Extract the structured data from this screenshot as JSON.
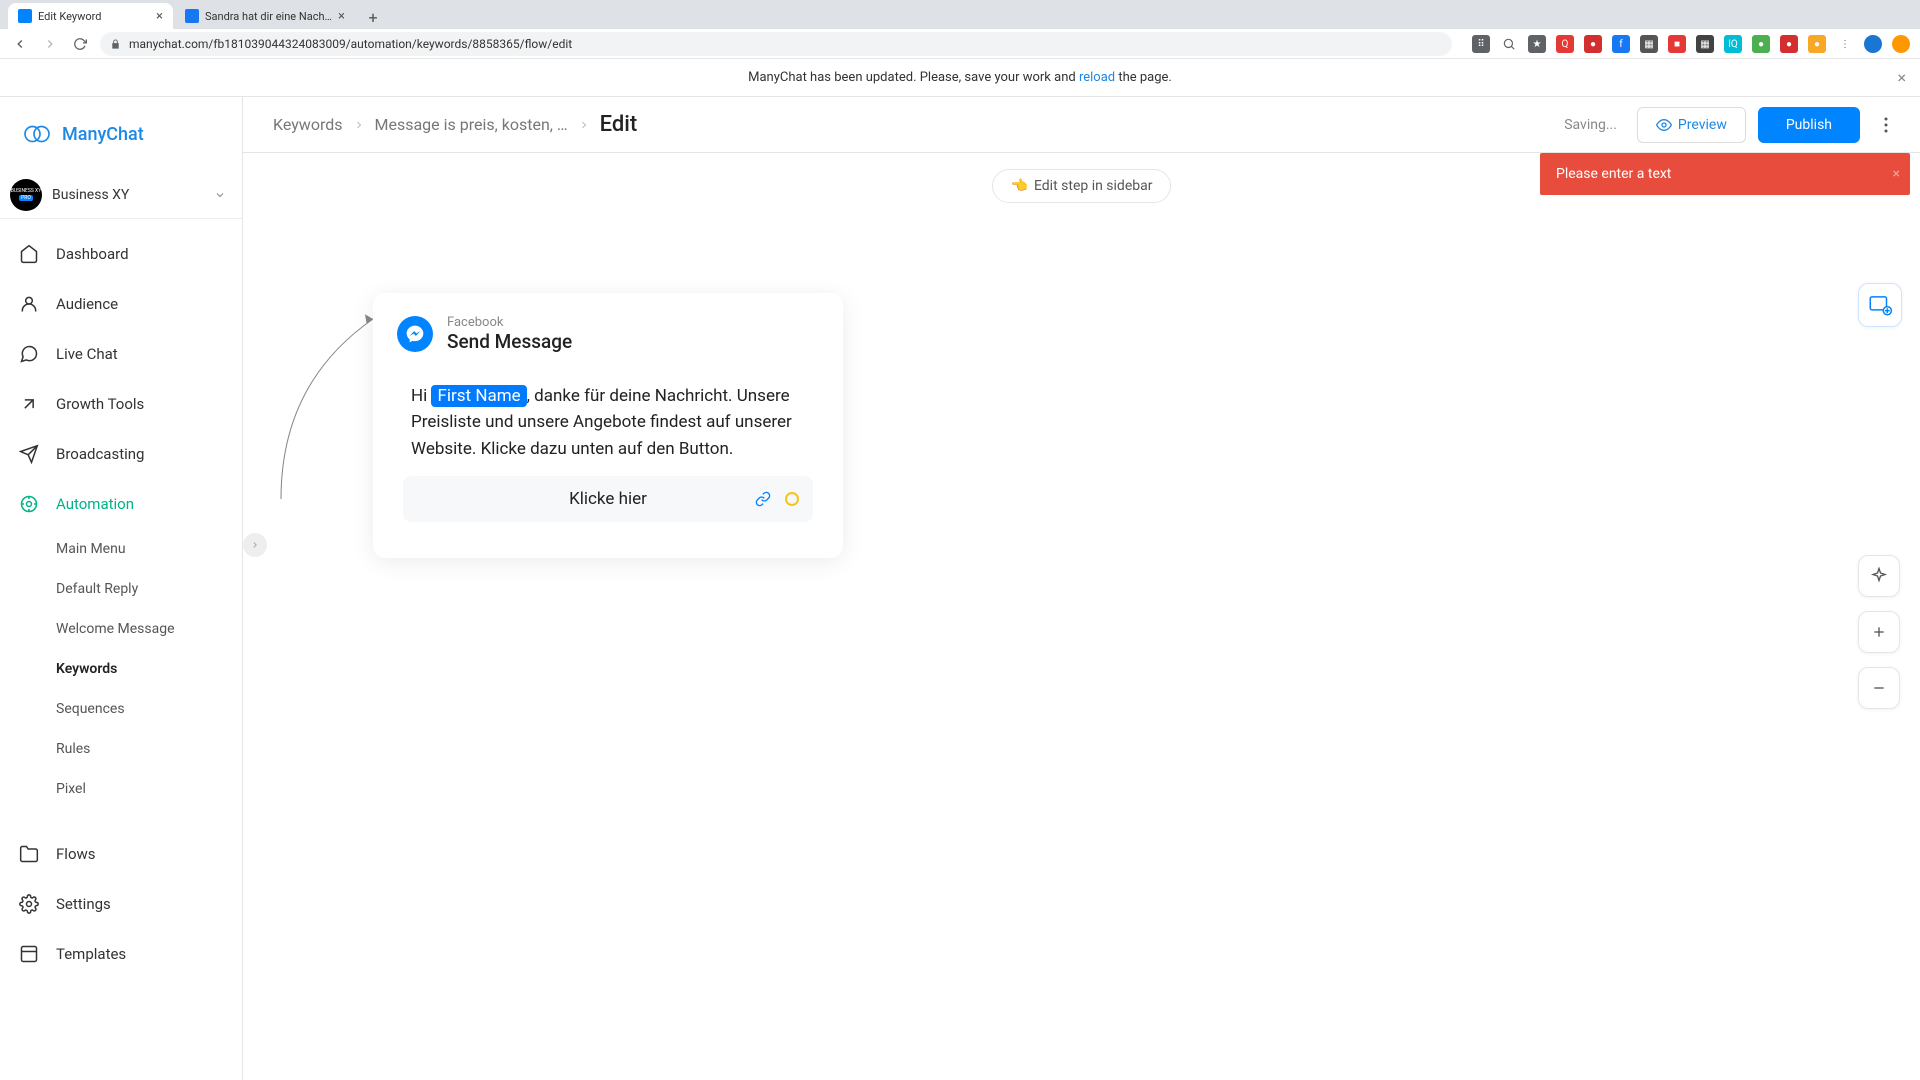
{
  "browser": {
    "tabs": [
      {
        "title": "Edit Keyword",
        "favicon_color": "#0084ff",
        "active": true
      },
      {
        "title": "Sandra hat dir eine Nachricht",
        "favicon_color": "#1877f2",
        "active": false
      }
    ],
    "url": "manychat.com/fb181039044324083009/automation/keywords/8858365/flow/edit"
  },
  "notification": {
    "prefix": "ManyChat has been updated. Please, save your work and ",
    "link": "reload",
    "suffix": " the page."
  },
  "app_name": "ManyChat",
  "workspace": {
    "name": "Business XY",
    "badge": "PRO"
  },
  "sidebar": {
    "items": [
      {
        "label": "Dashboard"
      },
      {
        "label": "Audience"
      },
      {
        "label": "Live Chat"
      },
      {
        "label": "Growth Tools"
      },
      {
        "label": "Broadcasting"
      },
      {
        "label": "Automation",
        "active": true
      },
      {
        "label": "Flows"
      },
      {
        "label": "Settings"
      },
      {
        "label": "Templates"
      }
    ],
    "automation_sub": [
      {
        "label": "Main Menu"
      },
      {
        "label": "Default Reply"
      },
      {
        "label": "Welcome Message"
      },
      {
        "label": "Keywords",
        "active": true
      },
      {
        "label": "Sequences"
      },
      {
        "label": "Rules"
      },
      {
        "label": "Pixel"
      }
    ]
  },
  "topbar": {
    "crumbs": {
      "root": "Keywords",
      "mid": "Message is preis, kosten, …",
      "current": "Edit"
    },
    "status": "Saving...",
    "preview": "Preview",
    "publish": "Publish"
  },
  "error_toast": "Please enter a text",
  "pill": "Edit step in sidebar",
  "card": {
    "platform": "Facebook",
    "action": "Send Message",
    "msg_hi": "Hi ",
    "msg_var": "First Name",
    "msg_rest": ", danke für deine Nachricht. Unsere Preisliste und unsere Angebote findest auf unserer Website. Klicke dazu unten auf den Button.",
    "button_label": "Klicke hier"
  }
}
